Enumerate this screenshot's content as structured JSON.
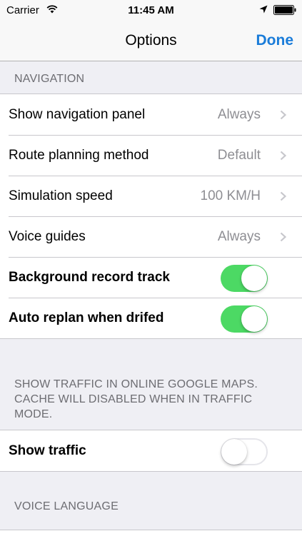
{
  "status_bar": {
    "carrier": "Carrier",
    "time": "11:45 AM",
    "icons": [
      "wifi-icon",
      "location-icon",
      "battery-icon"
    ]
  },
  "nav": {
    "title": "Options",
    "done_label": "Done"
  },
  "navigation_section": {
    "header": "NAVIGATION",
    "rows": [
      {
        "label": "Show navigation panel",
        "value": "Always",
        "accessory": "chevron-right-icon"
      },
      {
        "label": "Route planning method",
        "value": "Default",
        "accessory": "chevron-right-icon"
      },
      {
        "label": "Simulation speed",
        "value": "100 KM/H",
        "accessory": "chevron-right-icon"
      },
      {
        "label": "Voice guides",
        "value": "Always",
        "accessory": "chevron-right-icon"
      },
      {
        "label": "Background record track",
        "toggle": true
      },
      {
        "label": "Auto replan when drifed",
        "toggle": true
      }
    ]
  },
  "traffic_section": {
    "header": "SHOW TRAFFIC IN ONLINE GOOGLE MAPS. CACHE WILL DISABLED WHEN IN TRAFFIC MODE.",
    "rows": [
      {
        "label": "Show traffic",
        "toggle": false
      }
    ]
  },
  "voice_section": {
    "header": "VOICE LANGUAGE"
  },
  "colors": {
    "accent": "#1a7cd9",
    "toggle_on": "#4cd964",
    "background": "#efeff4",
    "secondary_text": "#8e8e93",
    "header_text": "#6d6d72"
  }
}
